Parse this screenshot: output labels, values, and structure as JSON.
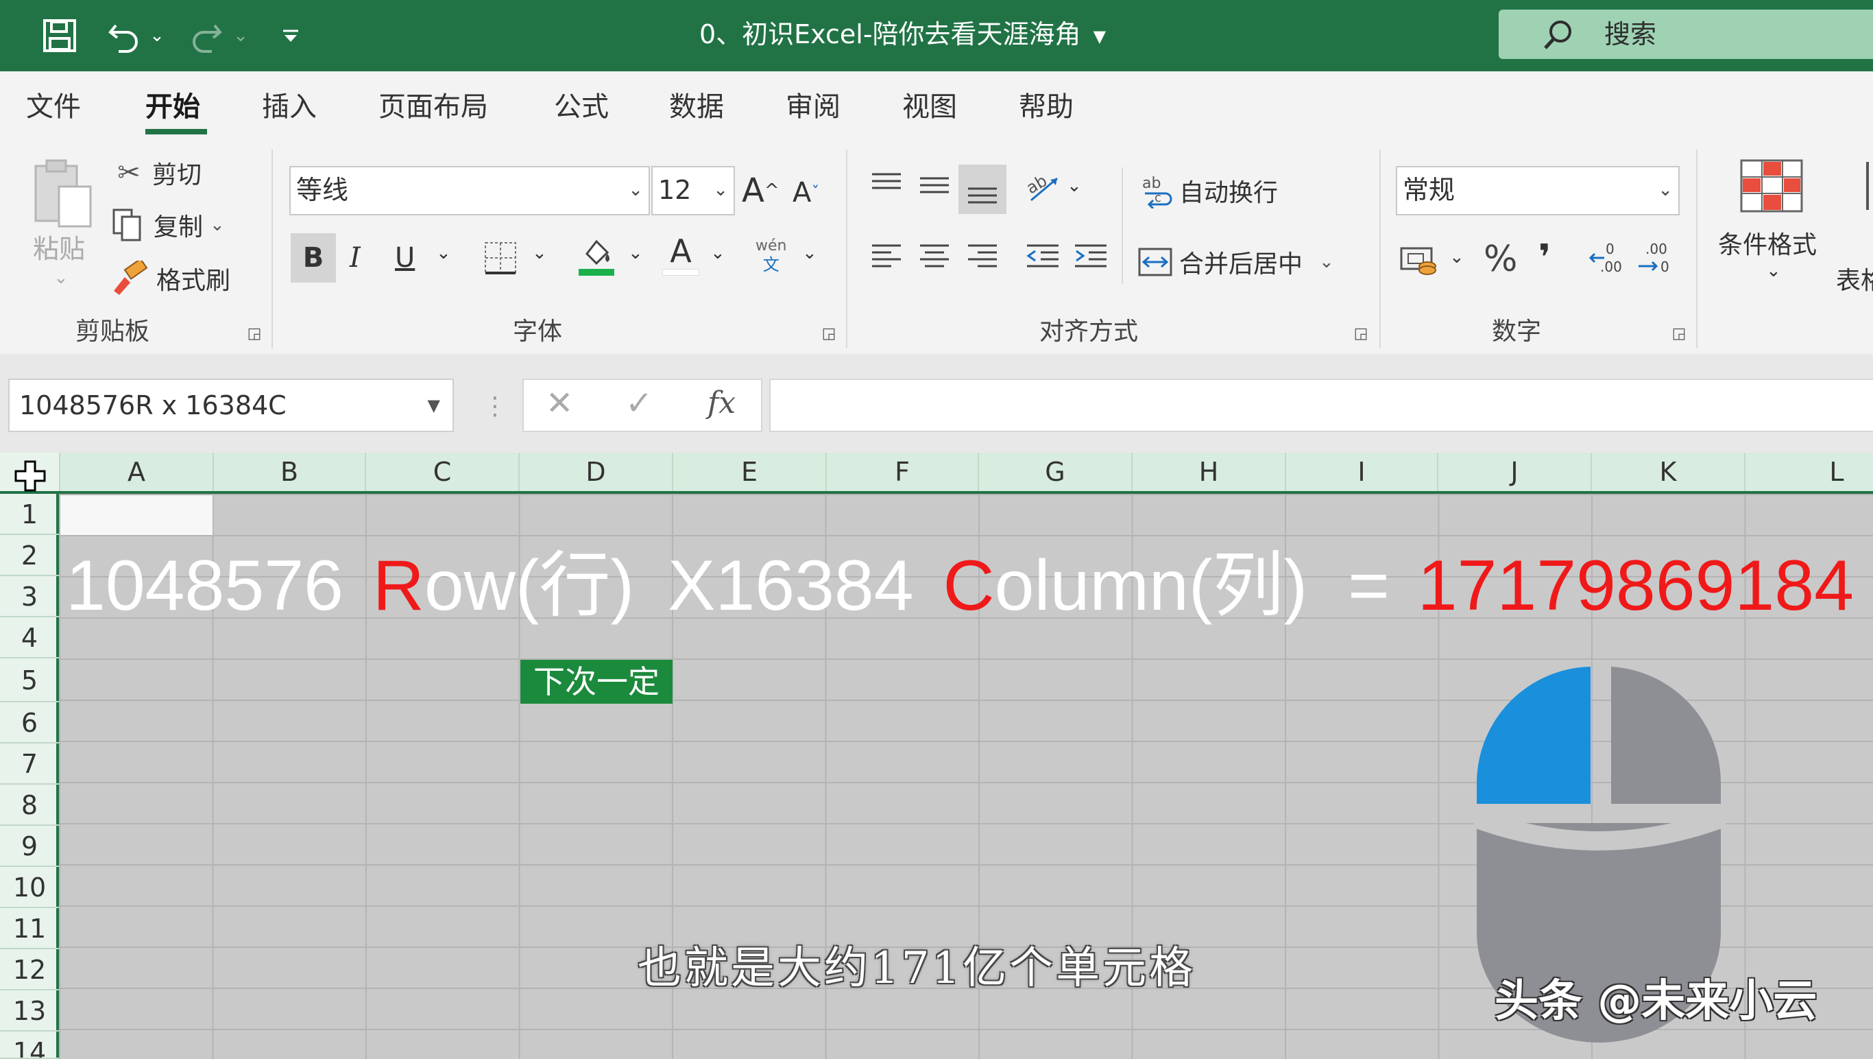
{
  "titlebar": {
    "title": "0、初识Excel-陪你去看天涯海角",
    "search_placeholder": "搜索"
  },
  "tabs": [
    "文件",
    "开始",
    "插入",
    "页面布局",
    "公式",
    "数据",
    "审阅",
    "视图",
    "帮助"
  ],
  "active_tab": "开始",
  "clipboard": {
    "paste": "粘贴",
    "cut": "剪切",
    "copy": "复制",
    "format_painter": "格式刷",
    "label": "剪贴板"
  },
  "font": {
    "name": "等线",
    "size": "12",
    "bold": "B",
    "italic": "I",
    "underline": "U",
    "label": "字体",
    "phonetic_top": "wén",
    "phonetic_bottom": "文"
  },
  "alignment": {
    "wrap_text": "自动换行",
    "merge_center": "合并后居中",
    "label": "对齐方式"
  },
  "number": {
    "format": "常规",
    "label": "数字",
    "percent": "%",
    "comma": "❜"
  },
  "styles": {
    "conditional_format": "条件格式",
    "table_format_partial": "表格"
  },
  "formula_bar": {
    "name_box": "1048576R x 16384C",
    "fx": "fx",
    "formula": ""
  },
  "grid": {
    "columns": [
      "A",
      "B",
      "C",
      "D",
      "E",
      "F",
      "G",
      "H",
      "I",
      "J",
      "K",
      "L"
    ],
    "rows": [
      "1",
      "2",
      "3",
      "4",
      "5",
      "6",
      "7",
      "8",
      "9",
      "10",
      "11",
      "12",
      "13",
      "14"
    ]
  },
  "overlay": {
    "rows_num": "1048576",
    "row_word_first": "R",
    "row_word_rest": "ow(行)",
    "times": "X",
    "cols_num": "16384",
    "col_word_first": "C",
    "col_word_rest": "olumn(列)",
    "equals": "=",
    "result": "17179869184"
  },
  "button_cell": "下次一定",
  "subtitle": "也就是大约171亿个单元格",
  "watermark": "头条 @未来小云",
  "colors": {
    "excel_green": "#217346",
    "accent_red": "#f01919",
    "mouse_blue": "#1a8fdc",
    "mouse_gray": "#8d8f95"
  }
}
